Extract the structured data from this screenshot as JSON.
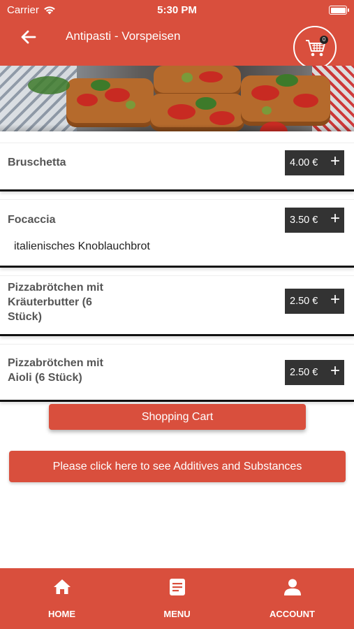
{
  "status_bar": {
    "carrier": "Carrier",
    "time": "5:30 PM"
  },
  "header": {
    "title": "Antipasti - Vorspeisen",
    "cart_count": "0"
  },
  "items": [
    {
      "name": "Bruschetta",
      "description": "",
      "price": "4.00 €"
    },
    {
      "name": "Focaccia",
      "description": "italienisches Knoblauchbrot",
      "price": "3.50 €"
    },
    {
      "name": "Pizzabrötchen mit Kräuterbutter (6 Stück)",
      "description": "",
      "price": "2.50 €"
    },
    {
      "name": "Pizzabrötchen mit Aioli (6 Stück)",
      "description": "",
      "price": "2.50 €"
    }
  ],
  "buttons": {
    "shopping_cart": "Shopping Cart",
    "additives": "Please click here to see Additives and Substances"
  },
  "tabs": [
    {
      "label": "HOME",
      "icon": "home-icon"
    },
    {
      "label": "MENU",
      "icon": "menu-icon"
    },
    {
      "label": "ACCOUNT",
      "icon": "account-icon"
    }
  ],
  "colors": {
    "accent": "#d94f3d",
    "price_bg": "#333333"
  }
}
